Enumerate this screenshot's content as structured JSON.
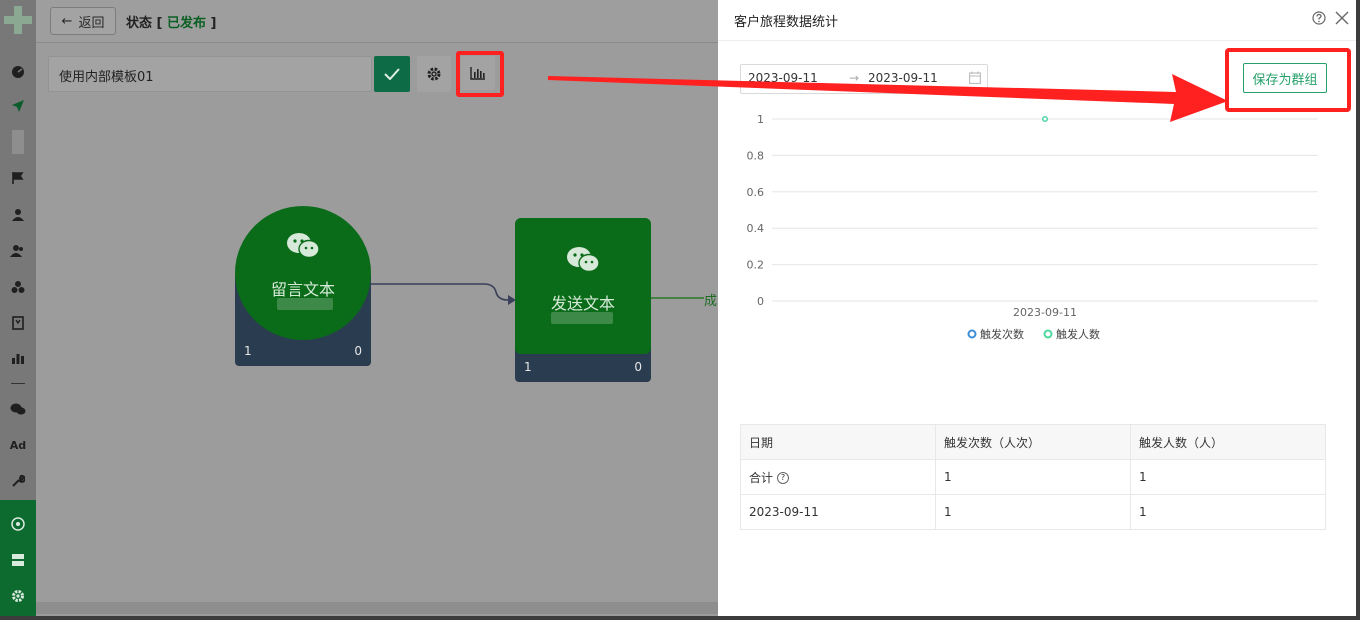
{
  "topbar": {
    "back_label": "返回",
    "status_label": "状态",
    "status_value": "已发布"
  },
  "canvas": {
    "template_name": "使用内部模板01",
    "nodes": [
      {
        "title": "留言文本",
        "left_count": "1",
        "right_count": "0"
      },
      {
        "title": "发送文本",
        "left_count": "1",
        "right_count": "0"
      }
    ],
    "edge_label": "成"
  },
  "panel": {
    "title": "客户旅程数据统计",
    "date_start": "2023-09-11",
    "date_end": "2023-09-11",
    "save_group_label": "保存为群组"
  },
  "chart_data": {
    "type": "line",
    "x": [
      "2023-09-11"
    ],
    "series": [
      {
        "name": "触发次数",
        "values": [
          1
        ],
        "color": "#3b8fd9"
      },
      {
        "name": "触发人数",
        "values": [
          1
        ],
        "color": "#4cd9a0"
      }
    ],
    "yticks": [
      "0",
      "0.2",
      "0.4",
      "0.6",
      "0.8",
      "1"
    ],
    "ylim": [
      0,
      1
    ],
    "legend_position": "bottom",
    "grid": true
  },
  "table": {
    "headers": [
      "日期",
      "触发次数（人次）",
      "触发人数（人）"
    ],
    "rows": [
      [
        "合计",
        "1",
        "1"
      ],
      [
        "2023-09-11",
        "1",
        "1"
      ]
    ]
  },
  "colors": {
    "brand_green": "#0a6b19",
    "accent": "#25a06a",
    "highlight_red": "#ff2020"
  }
}
